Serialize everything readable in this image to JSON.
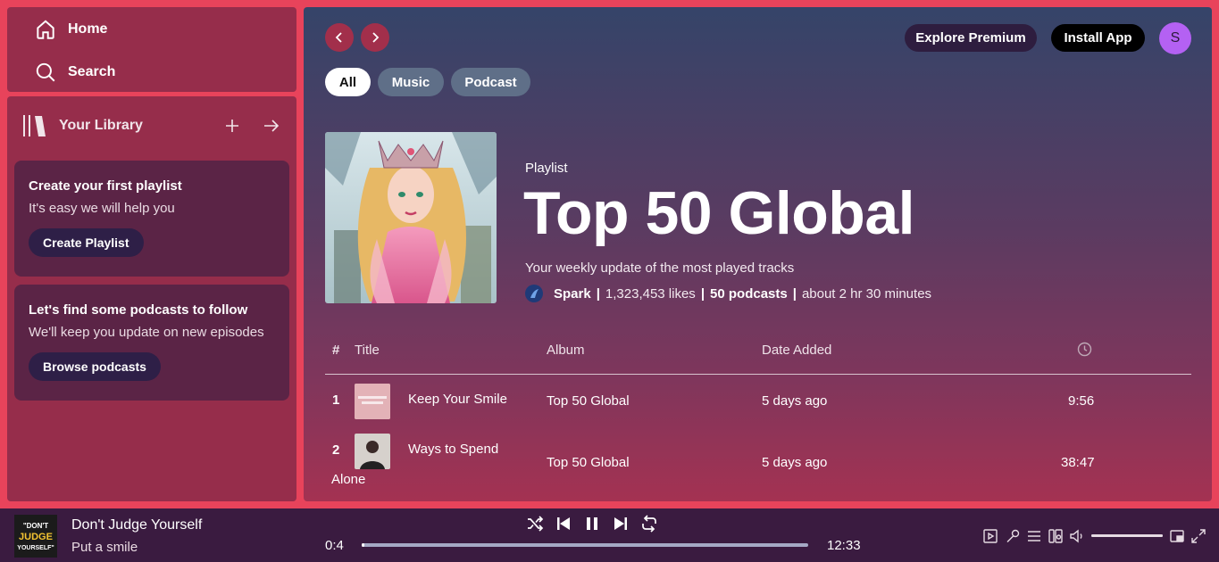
{
  "sidebar": {
    "nav": [
      {
        "label": "Home",
        "icon": "home-icon"
      },
      {
        "label": "Search",
        "icon": "search-icon"
      }
    ],
    "library": {
      "title": "Your Library",
      "icon": "library-icon",
      "cards": [
        {
          "title": "Create your first playlist",
          "subtitle": "It's easy we will help you",
          "button": "Create Playlist"
        },
        {
          "title": "Let's find some podcasts to follow",
          "subtitle": "We'll keep you update on new episodes",
          "button": "Browse podcasts"
        }
      ]
    }
  },
  "topbar": {
    "explore_premium": "Explore Premium",
    "install_app": "Install App",
    "avatar_initial": "S"
  },
  "filters": [
    "All",
    "Music",
    "Podcast"
  ],
  "playlist": {
    "type": "Playlist",
    "title": "Top 50 Global",
    "description": "Your weekly update of the most played tracks",
    "owner": "Spark",
    "likes": "1,323,453 likes",
    "count": "50 podcasts",
    "duration": "about 2 hr 30 minutes",
    "separator": "|"
  },
  "table": {
    "headers": {
      "num": "#",
      "title": "Title",
      "album": "Album",
      "date_added": "Date Added",
      "duration_icon": "clock-icon"
    },
    "rows": [
      {
        "num": "1",
        "title": "Keep Your Smile",
        "album": "Top 50 Global",
        "date_added": "5 days ago",
        "duration": "9:56"
      },
      {
        "num": "2",
        "title_line1": "Ways to Spend",
        "title_line2": "Alone",
        "album": "Top 50 Global",
        "date_added": "5 days ago",
        "duration": "38:47"
      }
    ]
  },
  "player": {
    "track": "Don't Judge Yourself",
    "artist": "Put a smile",
    "elapsed": "0:4",
    "total": "12:33",
    "progress": 0.005,
    "volume": 1.0,
    "art_text": [
      "\"DON'T",
      "JUDGE",
      "YOURSELF\""
    ]
  }
}
